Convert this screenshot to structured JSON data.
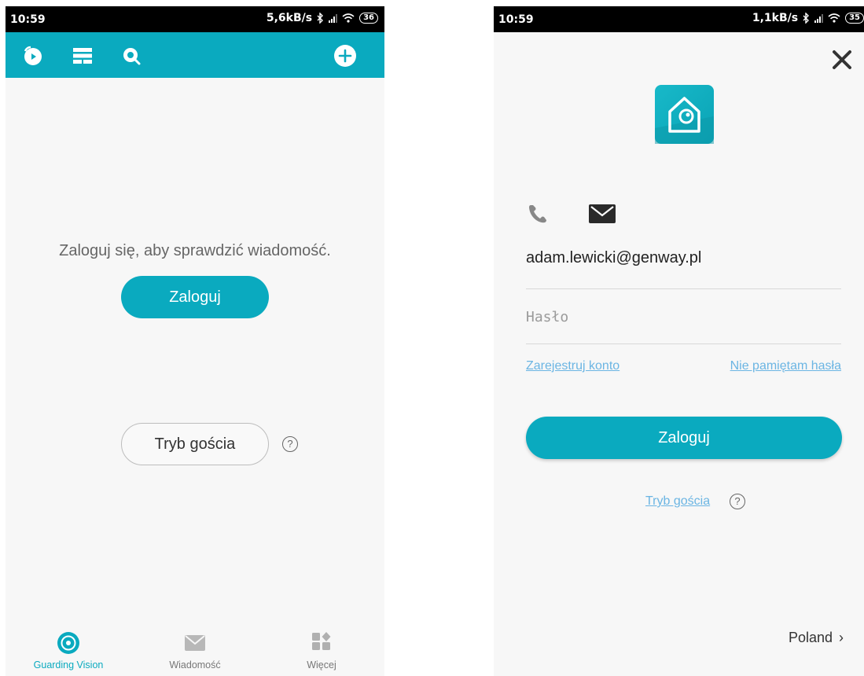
{
  "left_screen": {
    "statusbar": {
      "time": "10:59",
      "speed": "5,6kB/s",
      "battery": "36"
    },
    "message": "Zaloguj się, aby sprawdzić wiadomość.",
    "login_button": "Zaloguj",
    "guest_button": "Tryb gościa",
    "help_symbol": "?",
    "toolbar_icons": [
      "playback-icon",
      "layout-icon",
      "search-icon",
      "add-icon"
    ],
    "bottom_nav": [
      {
        "label": "Guarding Vision",
        "icon": "guarding-vision-icon",
        "active": true
      },
      {
        "label": "Wiadomość",
        "icon": "envelope-icon",
        "active": false
      },
      {
        "label": "Więcej",
        "icon": "more-grid-icon",
        "active": false
      }
    ]
  },
  "right_screen": {
    "statusbar": {
      "time": "10:59",
      "speed": "1,1kB/s",
      "battery": "35"
    },
    "login_tabs": [
      "phone-icon",
      "mail-icon"
    ],
    "email_value": "adam.lewicki@genway.pl",
    "password_placeholder": "Hasło",
    "register_link": "Zarejestruj konto",
    "forgot_link": "Nie pamiętam hasła",
    "login_button": "Zaloguj",
    "guest_link": "Tryb gościa",
    "help_symbol": "?",
    "country": "Poland"
  },
  "colors": {
    "accent": "#0aaabf",
    "link": "#6bb5e3",
    "background": "#f7f7f7"
  }
}
